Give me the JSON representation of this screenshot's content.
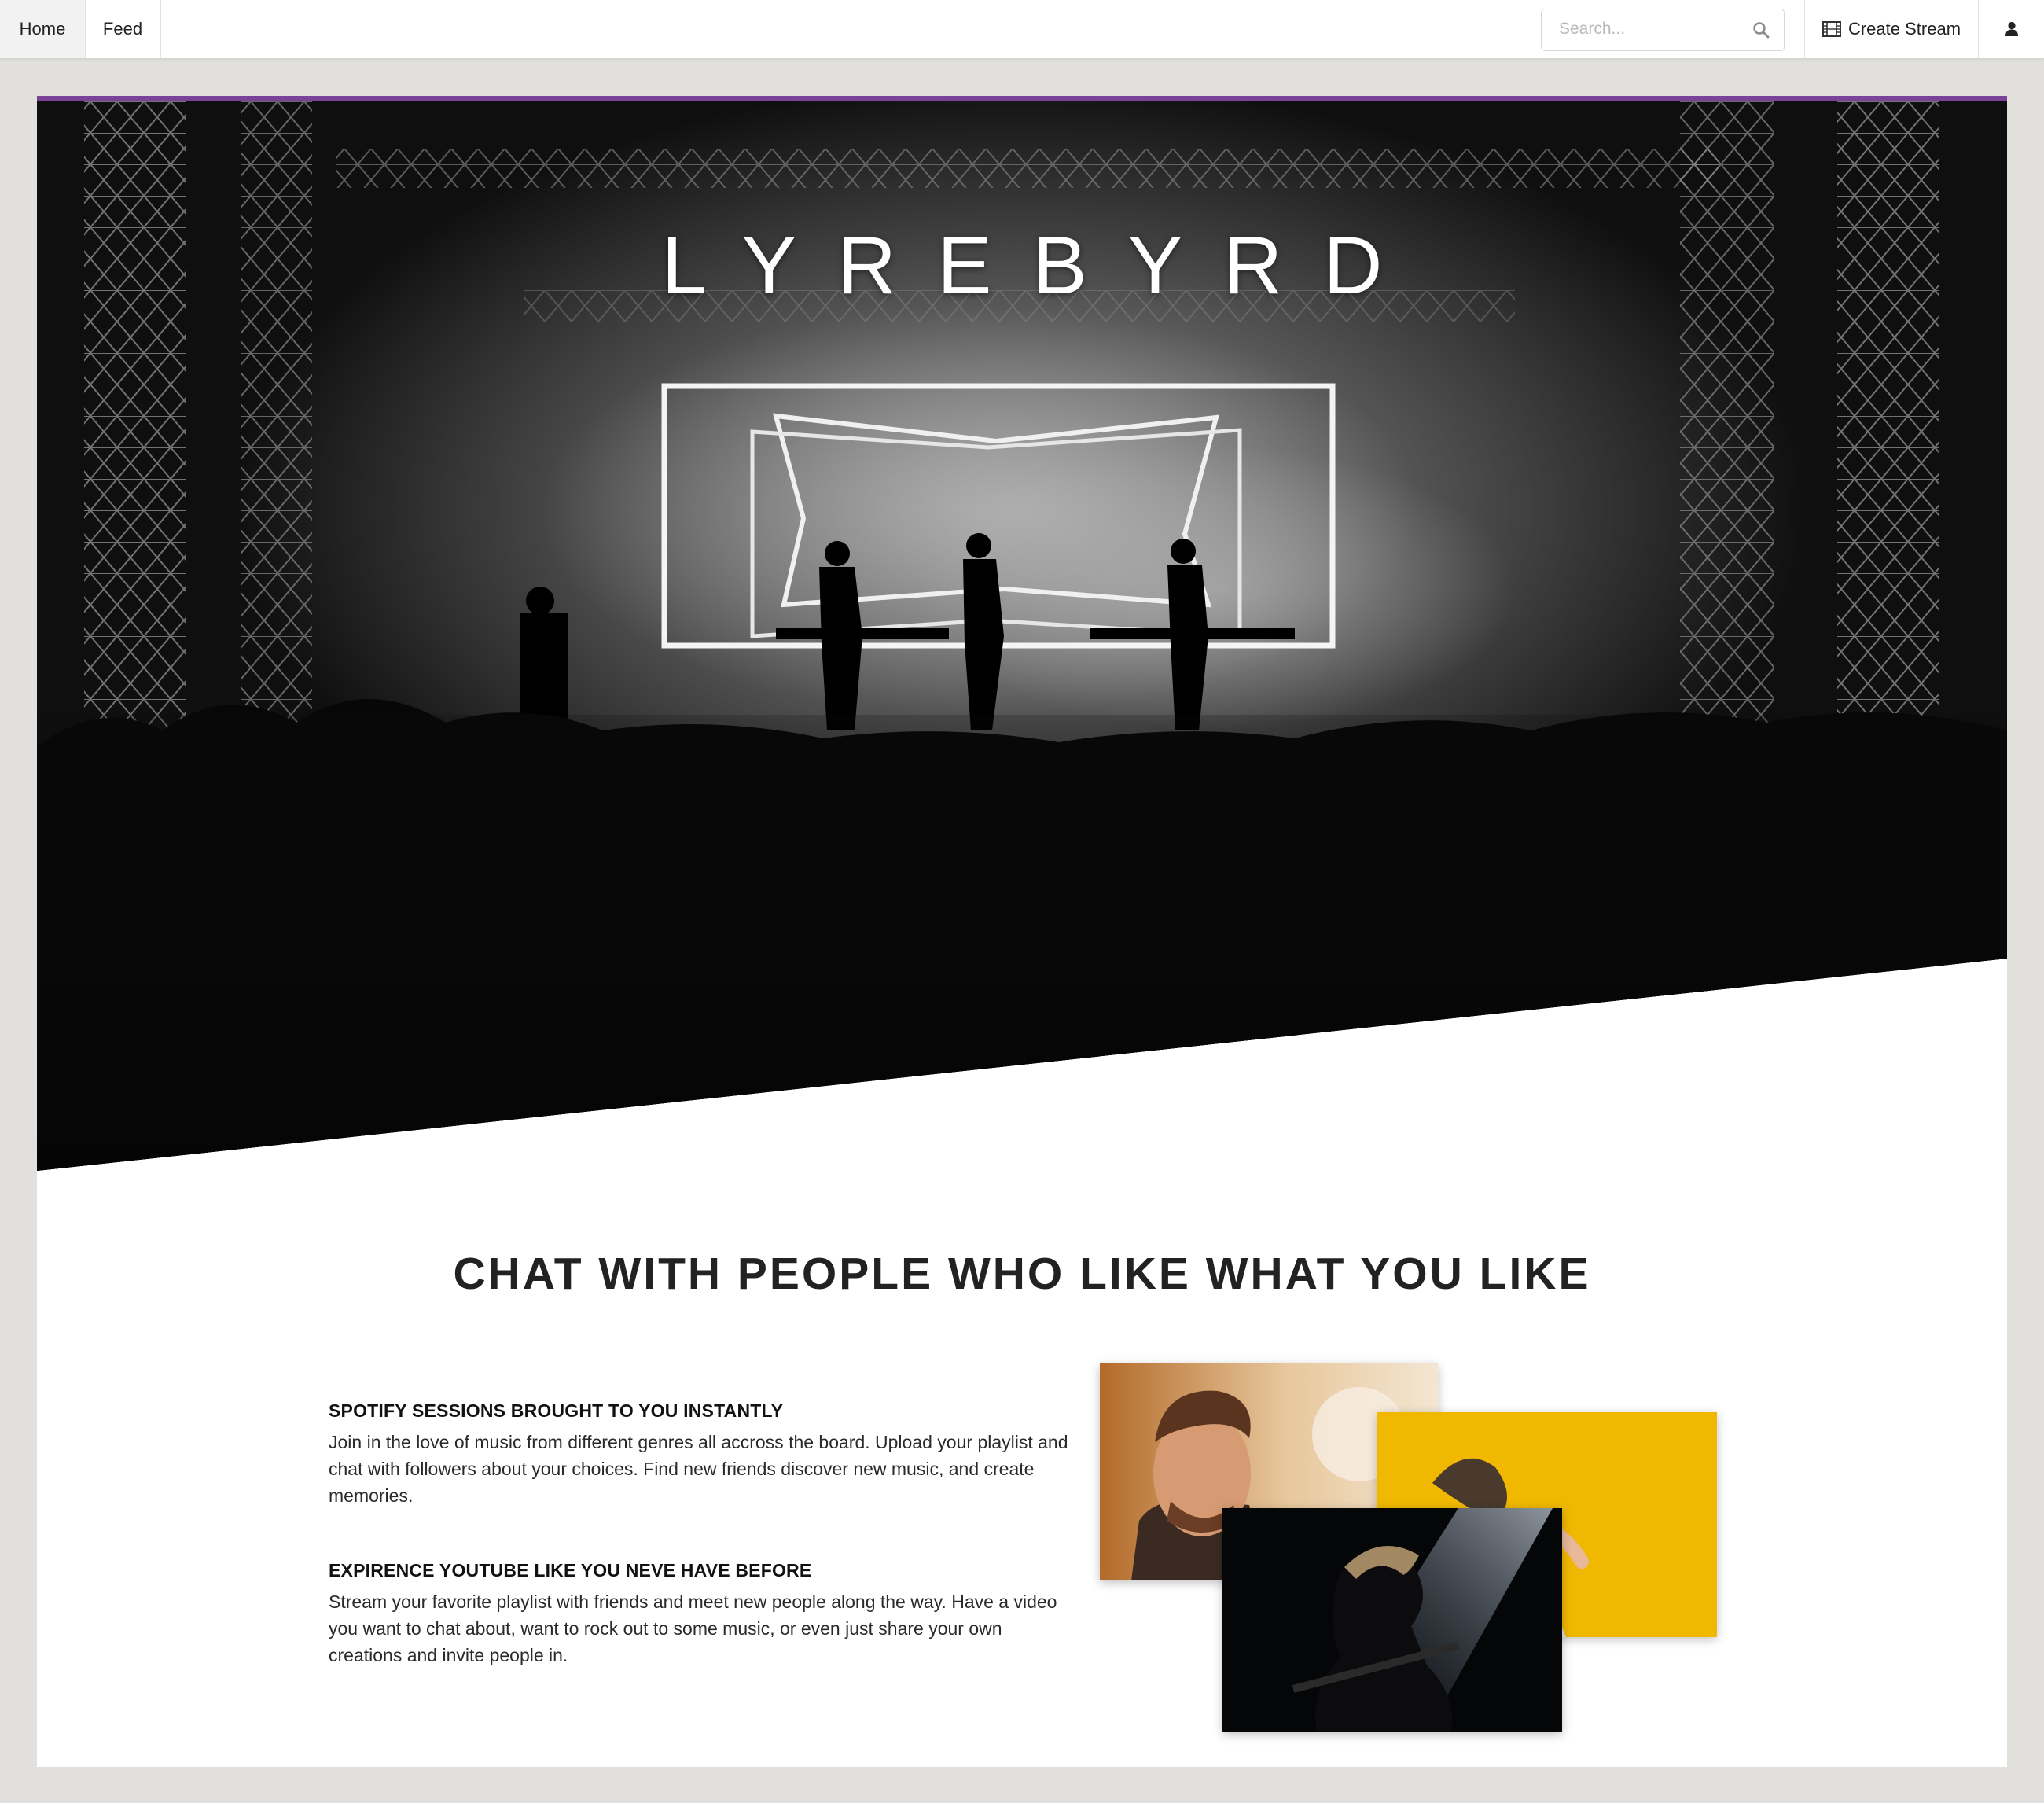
{
  "nav": {
    "home_label": "Home",
    "feed_label": "Feed",
    "search_placeholder": "Search...",
    "search_icon": "search-icon",
    "create_stream_label": "Create Stream",
    "create_stream_icon": "film-icon",
    "user_icon": "user-icon"
  },
  "colors": {
    "accent": "#7b4397",
    "page_background": "#e2e0dc"
  },
  "hero": {
    "brand": "LYREBYRD"
  },
  "section": {
    "title": "CHAT WITH PEOPLE WHO LIKE WHAT YOU LIKE",
    "features": [
      {
        "heading": "SPOTIFY SESSIONS BROUGHT TO YOU INSTANTLY",
        "text": "Join in the love of music from different genres all accross the board. Upload your playlist and chat with followers about your choices. Find new friends discover new music, and create memories."
      },
      {
        "heading": "EXPIRENCE YOUTUBE LIKE YOU NEVE HAVE BEFORE",
        "text": "Stream your favorite playlist with friends and meet new people along the way. Have a video you want to chat about, want to rock out to some music, or even just share your own creations and invite people in."
      }
    ]
  }
}
